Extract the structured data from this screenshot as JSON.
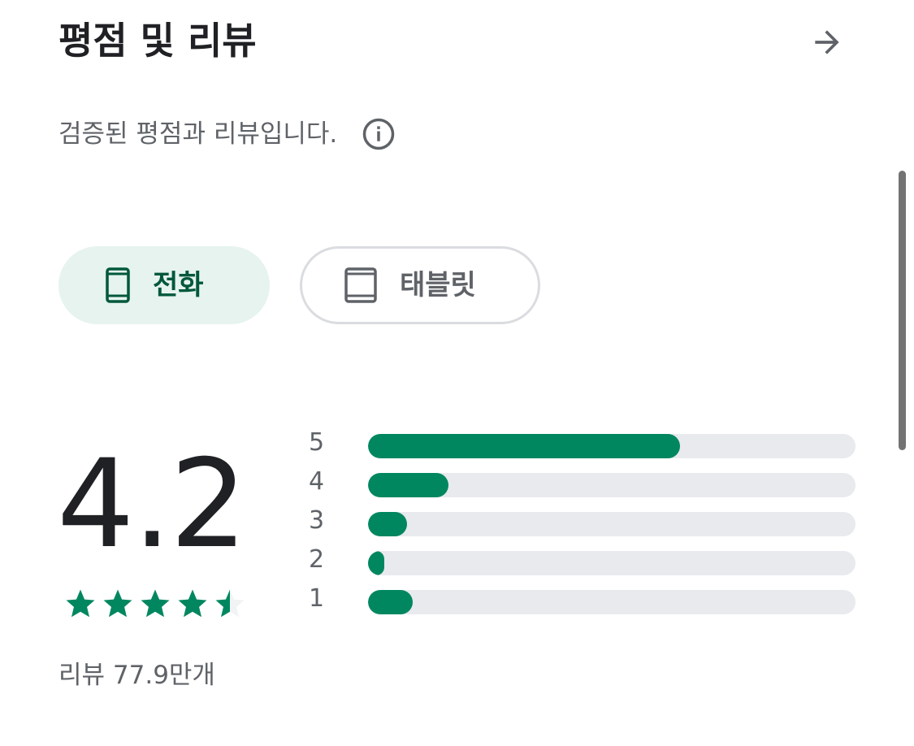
{
  "header": {
    "title": "평점 및 리뷰"
  },
  "subtitle": "검증된 평점과 리뷰입니다.",
  "chips": [
    {
      "label": "전화",
      "icon": "phone-icon",
      "selected": true
    },
    {
      "label": "태블릿",
      "icon": "tablet-icon",
      "selected": false
    }
  ],
  "rating": {
    "value": "4.2",
    "stars_filled": 4.5,
    "review_count": "리뷰 77.9만개"
  },
  "histogram": [
    {
      "label": "5",
      "fraction": 0.64
    },
    {
      "label": "4",
      "fraction": 0.165
    },
    {
      "label": "3",
      "fraction": 0.08
    },
    {
      "label": "2",
      "fraction": 0.033
    },
    {
      "label": "1",
      "fraction": 0.092
    }
  ],
  "colors": {
    "accent": "#01875f",
    "chip_selected_bg": "#e6f3ef",
    "chip_selected_text": "#01583a",
    "track": "#e8eaed",
    "secondary_text": "#5f6368"
  }
}
